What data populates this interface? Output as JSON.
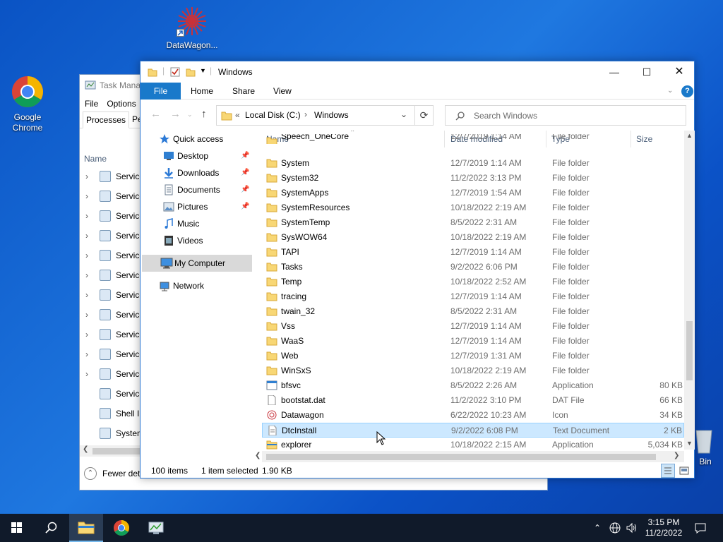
{
  "desktop": {
    "icons": [
      {
        "label": "DataWagon..."
      },
      {
        "label": "Google Chrome"
      },
      {
        "label": "Bin"
      }
    ]
  },
  "task_manager": {
    "title": "Task Manag",
    "menu": [
      "File",
      "Options"
    ],
    "tabs": [
      "Processes",
      "Per"
    ],
    "column": "Name",
    "rows": [
      "Service",
      "Service",
      "Service",
      "Service",
      "Service",
      "Service",
      "Service",
      "Service",
      "Service",
      "Service",
      "Service",
      "Service",
      "Shell Ir",
      "System"
    ],
    "footer": "Fewer det"
  },
  "explorer": {
    "title": "Windows",
    "ribbon": {
      "file": "File",
      "home": "Home",
      "share": "Share",
      "view": "View"
    },
    "address": {
      "root": "Local Disk (C:)",
      "current": "Windows"
    },
    "search_placeholder": "Search Windows",
    "nav": [
      {
        "label": "Quick access",
        "icon": "star-icon"
      },
      {
        "label": "Desktop",
        "icon": "desktop-icon",
        "pinned": true
      },
      {
        "label": "Downloads",
        "icon": "download-icon",
        "pinned": true
      },
      {
        "label": "Documents",
        "icon": "documents-icon",
        "pinned": true
      },
      {
        "label": "Pictures",
        "icon": "pictures-icon",
        "pinned": true
      },
      {
        "label": "Music",
        "icon": "music-icon"
      },
      {
        "label": "Videos",
        "icon": "videos-icon"
      },
      {
        "label": "My Computer",
        "icon": "computer-icon",
        "selected": true
      },
      {
        "label": "Network",
        "icon": "network-icon"
      }
    ],
    "columns": {
      "name": "Name",
      "date": "Date modified",
      "type": "Type",
      "size": "Size"
    },
    "files": [
      {
        "name": "Speech_OneCore",
        "date": "12/7/2019 1:14 AM",
        "type": "File folder",
        "size": "",
        "kind": "folder"
      },
      {
        "name": "System",
        "date": "12/7/2019 1:14 AM",
        "type": "File folder",
        "size": "",
        "kind": "folder"
      },
      {
        "name": "System32",
        "date": "11/2/2022 3:13 PM",
        "type": "File folder",
        "size": "",
        "kind": "folder"
      },
      {
        "name": "SystemApps",
        "date": "12/7/2019 1:54 AM",
        "type": "File folder",
        "size": "",
        "kind": "folder"
      },
      {
        "name": "SystemResources",
        "date": "10/18/2022 2:19 AM",
        "type": "File folder",
        "size": "",
        "kind": "folder"
      },
      {
        "name": "SystemTemp",
        "date": "8/5/2022 2:31 AM",
        "type": "File folder",
        "size": "",
        "kind": "folder"
      },
      {
        "name": "SysWOW64",
        "date": "10/18/2022 2:19 AM",
        "type": "File folder",
        "size": "",
        "kind": "folder"
      },
      {
        "name": "TAPI",
        "date": "12/7/2019 1:14 AM",
        "type": "File folder",
        "size": "",
        "kind": "folder"
      },
      {
        "name": "Tasks",
        "date": "9/2/2022 6:06 PM",
        "type": "File folder",
        "size": "",
        "kind": "folder"
      },
      {
        "name": "Temp",
        "date": "10/18/2022 2:52 AM",
        "type": "File folder",
        "size": "",
        "kind": "folder"
      },
      {
        "name": "tracing",
        "date": "12/7/2019 1:14 AM",
        "type": "File folder",
        "size": "",
        "kind": "folder"
      },
      {
        "name": "twain_32",
        "date": "8/5/2022 2:31 AM",
        "type": "File folder",
        "size": "",
        "kind": "folder"
      },
      {
        "name": "Vss",
        "date": "12/7/2019 1:14 AM",
        "type": "File folder",
        "size": "",
        "kind": "folder"
      },
      {
        "name": "WaaS",
        "date": "12/7/2019 1:14 AM",
        "type": "File folder",
        "size": "",
        "kind": "folder"
      },
      {
        "name": "Web",
        "date": "12/7/2019 1:31 AM",
        "type": "File folder",
        "size": "",
        "kind": "folder"
      },
      {
        "name": "WinSxS",
        "date": "10/18/2022 2:19 AM",
        "type": "File folder",
        "size": "",
        "kind": "folder"
      },
      {
        "name": "bfsvc",
        "date": "8/5/2022 2:26 AM",
        "type": "Application",
        "size": "80 KB",
        "kind": "app"
      },
      {
        "name": "bootstat.dat",
        "date": "11/2/2022 3:10 PM",
        "type": "DAT File",
        "size": "66 KB",
        "kind": "file"
      },
      {
        "name": "Datawagon",
        "date": "6/22/2022 10:23 AM",
        "type": "Icon",
        "size": "34 KB",
        "kind": "icon"
      },
      {
        "name": "DtcInstall",
        "date": "9/2/2022 6:08 PM",
        "type": "Text Document",
        "size": "2 KB",
        "kind": "text",
        "selected": true
      },
      {
        "name": "explorer",
        "date": "10/18/2022 2:15 AM",
        "type": "Application",
        "size": "5,034 KB",
        "kind": "explorer"
      }
    ],
    "status": {
      "count": "100 items",
      "selection": "1 item selected",
      "size": "1.90 KB"
    }
  },
  "taskbar": {
    "time": "3:15 PM",
    "date": "11/2/2022"
  }
}
